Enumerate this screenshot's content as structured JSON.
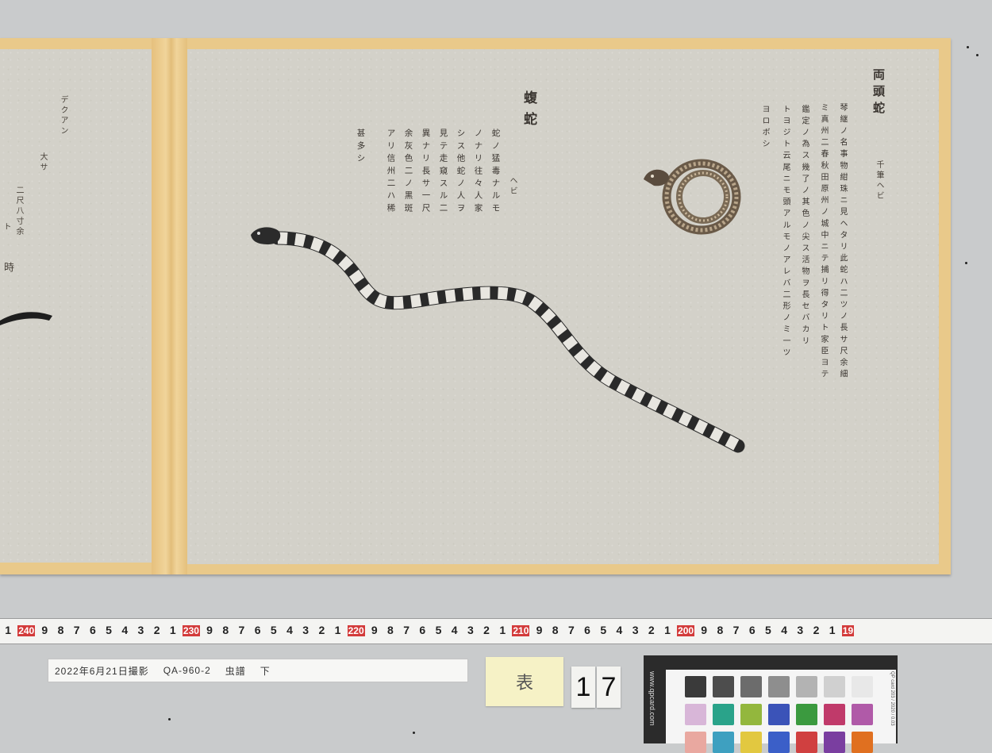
{
  "left_page": {
    "col1": "デクアン",
    "col2": "大サ",
    "col3": "二尺八寸余",
    "col4": "ト",
    "col5": "時"
  },
  "right_page": {
    "title": "蝮蛇",
    "reading": "ヘビ",
    "description_columns": [
      "蛇ノ猛毒ナルモ",
      "ノナリ往々人家",
      "シス他蛇ノ人ヲ",
      "見テ走窺スル二",
      "異ナリ長サ一尺",
      "余灰色二ノ黒斑",
      "アリ信州二ハ稀",
      "甚多シ"
    ],
    "second_title": "両頭蛇",
    "second_reading": "ヘビ",
    "second_subtitle": "千筆ヘビ",
    "second_columns": [
      "琴継ノ名事物紺珠ニ見ヘタリ此蛇ハ二ツノ長サ尺余細",
      "ミ真州二春秋田原州ノ城中ニテ捕リ得タリト家臣ヨテ",
      "鑑定ノ為ス幾了ノ其色ノ尖ス活物ヲ長セバカリ",
      "トヨジト云尾ニモ頭アルモノアレバ二形ノミ一ツ",
      "ヨロボシ"
    ]
  },
  "ruler": {
    "labels": [
      "1",
      "240",
      "9",
      "8",
      "7",
      "6",
      "5",
      "4",
      "3",
      "2",
      "1",
      "230",
      "9",
      "8",
      "7",
      "6",
      "5",
      "4",
      "3",
      "2",
      "1",
      "220",
      "9",
      "8",
      "7",
      "6",
      "5",
      "4",
      "3",
      "2",
      "1",
      "210",
      "9",
      "8",
      "7",
      "6",
      "5",
      "4",
      "3",
      "2",
      "1",
      "200",
      "9",
      "8",
      "7",
      "6",
      "5",
      "4",
      "3",
      "2",
      "1",
      "19"
    ]
  },
  "caption": {
    "date": "2022年6月21日撮影",
    "id": "QA-960-2",
    "title": "虫譜",
    "volume": "下"
  },
  "sticky_note": "表",
  "page_number": [
    "1",
    "7"
  ],
  "color_card": {
    "brand": "www.qpcard.com",
    "code": "QP card 203 / 2020 / 0.03"
  },
  "swatch_colors": [
    "#3a3a3a",
    "#4d4d4d",
    "#6c6c6c",
    "#8e8e8e",
    "#b3b3b3",
    "#d0d0d0",
    "#e8e8e8",
    "#d8b6d8",
    "#2aa38a",
    "#93b73d",
    "#3b53b8",
    "#3b9a3f",
    "#c03a6a",
    "#b05aa8",
    "#e9a8a0",
    "#3ea0c0",
    "#e2c840",
    "#3b5fc8",
    "#d04040",
    "#7a3ea0",
    "#e07020"
  ]
}
